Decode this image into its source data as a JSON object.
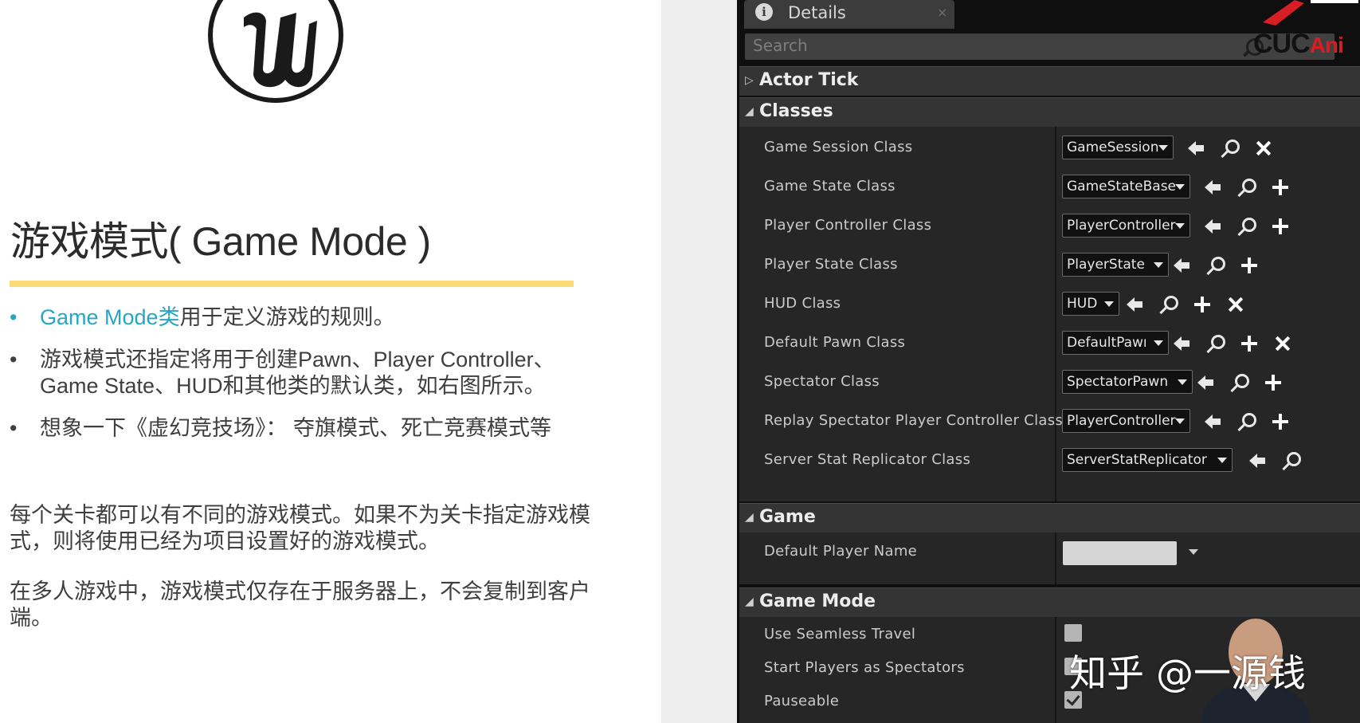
{
  "slide": {
    "title": "游戏模式( Game Mode )",
    "bullets": [
      {
        "dot": "•",
        "highlight": "Game Mode类",
        "text": "用于定义游戏的规则。"
      },
      {
        "dot": "•",
        "highlight": "",
        "text": "游戏模式还指定将用于创建Pawn、Player Controller、Game State、HUD和其他类的默认类，如右图所示。"
      },
      {
        "dot": "•",
        "highlight": "",
        "text": "想象一下《虚幻竞技场》： 夺旗模式、死亡竞赛模式等"
      }
    ],
    "paragraph_1": "每个关卡都可以有不同的游戏模式。如果不为关卡指定游戏模式，则将使用已经为项目设置好的游戏模式。",
    "paragraph_2": "在多人游戏中，游戏模式仅存在于服务器上，不会复制到客户端。",
    "accent_color": "#26a6c4",
    "rule_color": "#fcd975"
  },
  "details": {
    "tab_label": "Details",
    "tab_icon": "info-icon",
    "tab_close": "×",
    "search_placeholder": "Search",
    "brand_text": "CUC",
    "brand_suffix": "Ani",
    "categories": {
      "actor_tick": "Actor Tick",
      "classes": "Classes",
      "game": "Game",
      "game_mode": "Game Mode"
    },
    "classes_rows": [
      {
        "label": "Game Session Class",
        "value": "GameSession",
        "icons": [
          "arrow-left-icon",
          "browse-icon",
          "clear-icon"
        ]
      },
      {
        "label": "Game State Class",
        "value": "GameStateBase",
        "icons": [
          "arrow-left-icon",
          "browse-icon",
          "add-icon"
        ]
      },
      {
        "label": "Player Controller Class",
        "value": "PlayerController",
        "icons": [
          "arrow-left-icon",
          "browse-icon",
          "add-icon"
        ]
      },
      {
        "label": "Player State Class",
        "value": "PlayerState",
        "icons": [
          "arrow-left-icon",
          "browse-icon",
          "add-icon"
        ]
      },
      {
        "label": "HUD Class",
        "value": "HUD",
        "icons": [
          "arrow-left-icon",
          "browse-icon",
          "add-icon",
          "clear-icon"
        ]
      },
      {
        "label": "Default Pawn Class",
        "value": "DefaultPawı",
        "icons": [
          "arrow-left-icon",
          "browse-icon",
          "add-icon",
          "clear-icon"
        ]
      },
      {
        "label": "Spectator Class",
        "value": "SpectatorPawn",
        "icons": [
          "arrow-left-icon",
          "browse-icon",
          "add-icon"
        ]
      },
      {
        "label": "Replay Spectator Player Controller Class",
        "value": "PlayerController",
        "icons": [
          "arrow-left-icon",
          "browse-icon",
          "add-icon"
        ]
      },
      {
        "label": "Server Stat Replicator Class",
        "value": "ServerStatReplicator",
        "icons": [
          "arrow-left-icon",
          "browse-icon"
        ]
      }
    ],
    "game_rows": [
      {
        "label": "Default Player Name",
        "value": ""
      }
    ],
    "game_mode_rows": [
      {
        "label": "Use Seamless Travel",
        "checked": false
      },
      {
        "label": "Start Players as Spectators",
        "checked": false
      },
      {
        "label": "Pauseable",
        "checked": true
      }
    ]
  },
  "watermark": "知乎 @一源钱"
}
